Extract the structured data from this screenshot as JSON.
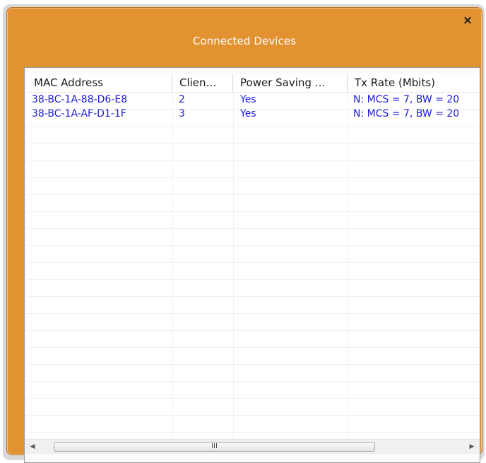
{
  "window": {
    "title": "Connected Devices",
    "close_glyph": "×"
  },
  "table": {
    "columns": [
      "MAC Address",
      "Clien…",
      "Power Saving …",
      "Tx Rate (Mbits)"
    ],
    "rows": [
      {
        "mac": "38-BC-1A-88-D6-E8",
        "client": "2",
        "power_saving": "Yes",
        "tx_rate": "N: MCS = 7, BW = 20"
      },
      {
        "mac": "38-BC-1A-AF-D1-1F",
        "client": "3",
        "power_saving": "Yes",
        "tx_rate": "N: MCS = 7, BW = 20"
      }
    ]
  },
  "scrollbar": {
    "left_arrow": "◀",
    "right_arrow": "▶",
    "thumb_grip": "III"
  },
  "colors": {
    "title_bar": "#e39232",
    "link_text": "#1a1ad6"
  }
}
